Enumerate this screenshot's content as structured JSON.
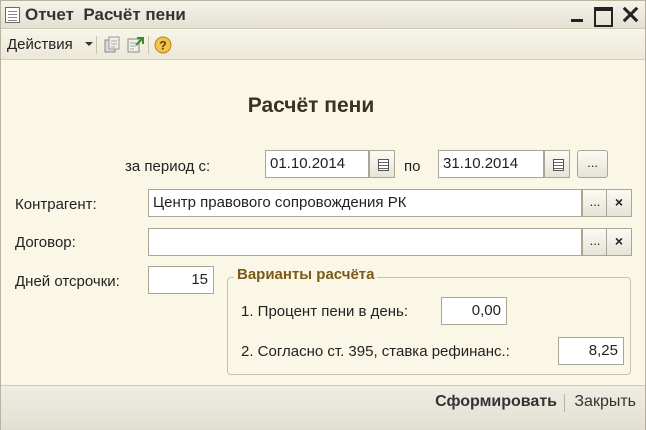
{
  "window": {
    "title": "Отчет  Расчёт пени"
  },
  "toolbar": {
    "actions_label": "Действия",
    "icons": [
      "report-settings-icon",
      "export-icon",
      "help-icon"
    ]
  },
  "form": {
    "heading": "Расчёт пени",
    "period_label": "за период с:",
    "period_from": "01.10.2014",
    "period_to_label": "по",
    "period_to": "31.10.2014",
    "counterparty_label": "Контрагент:",
    "counterparty_value": "Центр правового сопровождения РК",
    "contract_label": "Договор:",
    "contract_value": "",
    "grace_days_label": "Дней отсрочки:",
    "grace_days_value": "15",
    "options_title": "Варианты расчёта",
    "option1_label": "1. Процент пени в день:",
    "option1_value": "0,00",
    "option2_label": "2. Согласно ст. 395, ставка рефинанс.:",
    "option2_value": "8,25",
    "select_button": "...",
    "clear_button": "×"
  },
  "footer": {
    "generate_label": "Сформировать",
    "close_label": "Закрыть"
  },
  "colors": {
    "background": "#fbf7e6",
    "group_title": "#7a5a16",
    "heading": "#3a3324"
  }
}
